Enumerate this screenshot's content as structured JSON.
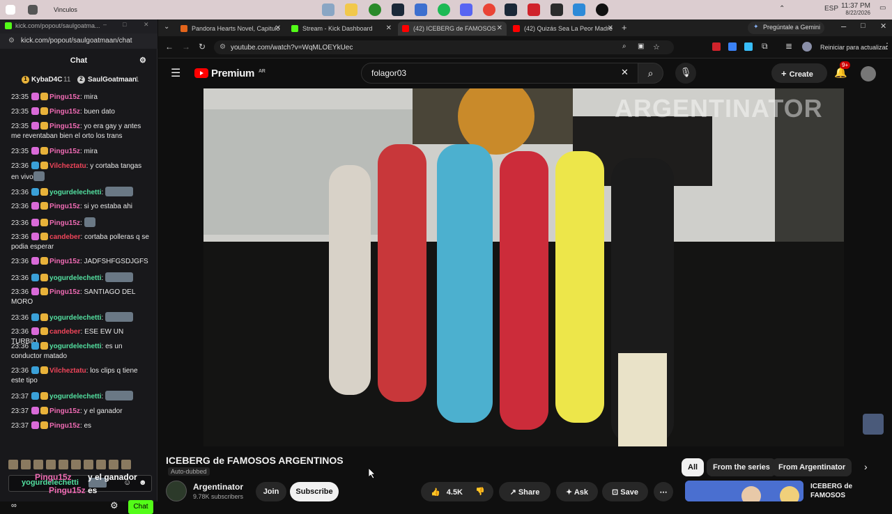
{
  "taskbar": {
    "app_label": "Vinculos",
    "lang": "ESP",
    "time": "11:37 PM",
    "date": "8/22/2026"
  },
  "popout": {
    "title": "kick.com/popout/saulgoatma...",
    "url": "kick.com/popout/saulgoatmaan/chat",
    "chat_title": "Chat",
    "leaders": [
      {
        "rank": "1",
        "name": "KybaD4C",
        "count": "11"
      },
      {
        "rank": "2",
        "name": "SaulGoatmaan",
        "count": "1"
      }
    ],
    "messages": [
      {
        "time": "23:35",
        "user": "Pingu15z",
        "color": "#f06bb4",
        "badge_color": "#d96ad8",
        "text": "mira"
      },
      {
        "time": "23:35",
        "user": "Pingu15z",
        "color": "#f06bb4",
        "badge_color": "#d96ad8",
        "text": "buen dato"
      },
      {
        "time": "23:35",
        "user": "Pingu15z",
        "color": "#f06bb4",
        "badge_color": "#d96ad8",
        "text": "yo era gay y antes me reventaban bien el orto los trans"
      },
      {
        "time": "23:35",
        "user": "Pingu15z",
        "color": "#f06bb4",
        "badge_color": "#d96ad8",
        "text": "mira"
      },
      {
        "time": "23:36",
        "user": "Vilcheztatu",
        "color": "#f0455a",
        "badge_color": "#3aa0d8",
        "text": "y cortaba tangas en vivo"
      },
      {
        "time": "23:36",
        "user": "yogurdelechetti",
        "color": "#53e0a0",
        "badge_color": "#3aa0d8",
        "text": ""
      },
      {
        "time": "23:36",
        "user": "Pingu15z",
        "color": "#f06bb4",
        "badge_color": "#d96ad8",
        "text": "si yo estaba ahi"
      },
      {
        "time": "23:36",
        "user": "Pingu15z",
        "color": "#f06bb4",
        "badge_color": "#d96ad8",
        "text": ""
      },
      {
        "time": "23:36",
        "user": "candeber",
        "color": "#f0455a",
        "badge_color": "#d96ad8",
        "text": "cortaba polleras q se podia esperar"
      },
      {
        "time": "23:36",
        "user": "Pingu15z",
        "color": "#f06bb4",
        "badge_color": "#d96ad8",
        "text": "JADFSHFGSDJGFS"
      },
      {
        "time": "23:36",
        "user": "yogurdelechetti",
        "color": "#53e0a0",
        "badge_color": "#3aa0d8",
        "text": ""
      },
      {
        "time": "23:36",
        "user": "Pingu15z",
        "color": "#f06bb4",
        "badge_color": "#d96ad8",
        "text": "SANTIAGO DEL MORO"
      },
      {
        "time": "23:36",
        "user": "yogurdelechetti",
        "color": "#53e0a0",
        "badge_color": "#3aa0d8",
        "text": ""
      },
      {
        "time": "23:36",
        "user": "candeber",
        "color": "#f0455a",
        "badge_color": "#d96ad8",
        "text": "ESE EW UN TURBIO"
      },
      {
        "time": "23:36",
        "user": "yogurdelechetti",
        "color": "#53e0a0",
        "badge_color": "#3aa0d8",
        "text": "es un conductor matado"
      },
      {
        "time": "23:36",
        "user": "Vilcheztatu",
        "color": "#f0455a",
        "badge_color": "#3aa0d8",
        "text": "los clips q tiene este tipo"
      },
      {
        "time": "23:37",
        "user": "yogurdelechetti",
        "color": "#53e0a0",
        "badge_color": "#3aa0d8",
        "text": ""
      },
      {
        "time": "23:37",
        "user": "Pingu15z",
        "color": "#f06bb4",
        "badge_color": "#d96ad8",
        "text": "y el ganador"
      },
      {
        "time": "23:37",
        "user": "Pingu15z",
        "color": "#f06bb4",
        "badge_color": "#d96ad8",
        "text": "es"
      }
    ],
    "overlay_lines": [
      {
        "user": "yogurdelechetti",
        "text": ""
      },
      {
        "user": "Pingu15z",
        "text": "y el ganador"
      },
      {
        "user": "Pingu15z",
        "text": "es"
      }
    ],
    "send_label": "Chat"
  },
  "browser": {
    "tabs": [
      {
        "label": "Pandora Hearts Novel, Capitulo",
        "fav_color": "#e3641b"
      },
      {
        "label": "Stream - Kick Dashboard",
        "fav_color": "#53fc18"
      },
      {
        "label": "(42) ICEBERG de FAMOSOS",
        "fav_color": "#ff0000"
      },
      {
        "label": "(42) Quizás Sea La Peor Madre",
        "fav_color": "#ff0000"
      }
    ],
    "gemini_label": "Pregúntale a Gemini",
    "url": "youtube.com/watch?v=WqMLOEYkUec",
    "restart_label": "Reiniciar para actualizar"
  },
  "youtube": {
    "logo_text": "Premium",
    "logo_region": "AR",
    "search_value": "folagor03",
    "create_label": "Create",
    "notif_badge": "9+",
    "video_watermark": "ARGENTINATOR",
    "video_title": "ICEBERG de FAMOSOS ARGENTINOS",
    "auto_dubbed": "Auto-dubbed",
    "channel_name": "Argentinator",
    "channel_subs": "9.78K subscribers",
    "join_label": "Join",
    "subscribe_label": "Subscribe",
    "like_count": "4.5K",
    "share_label": "Share",
    "ask_label": "Ask",
    "save_label": "Save",
    "chips": [
      "All",
      "From the series",
      "From Argentinator"
    ],
    "rec_title": "ICEBERG de FAMOSOS"
  },
  "colors": {
    "kick_green": "#53fc18",
    "yt_red": "#ff0000"
  }
}
